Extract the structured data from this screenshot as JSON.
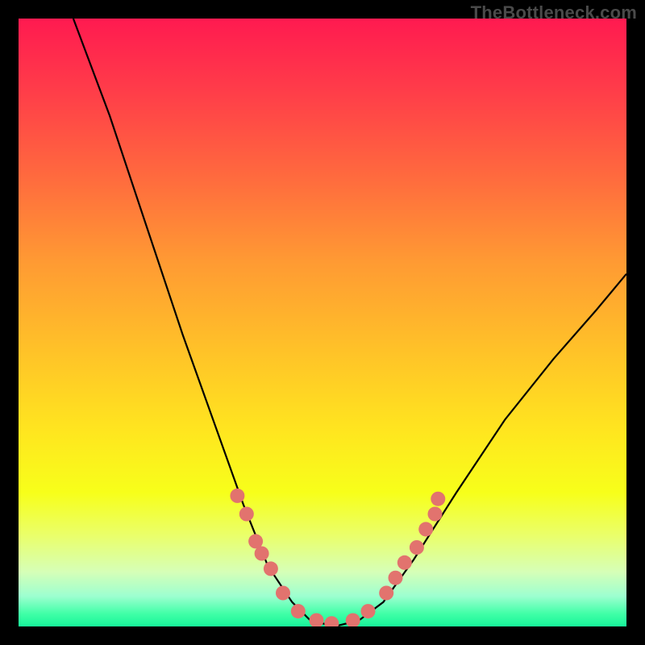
{
  "watermark": "TheBottleneck.com",
  "chart_data": {
    "type": "line",
    "title": "",
    "xlabel": "",
    "ylabel": "",
    "xlim": [
      0,
      100
    ],
    "ylim": [
      0,
      100
    ],
    "grid": false,
    "series": [
      {
        "name": "curve",
        "points": [
          {
            "x": 9,
            "y": 100
          },
          {
            "x": 15,
            "y": 84
          },
          {
            "x": 21,
            "y": 66
          },
          {
            "x": 27,
            "y": 48
          },
          {
            "x": 32,
            "y": 34
          },
          {
            "x": 37,
            "y": 20
          },
          {
            "x": 41,
            "y": 10
          },
          {
            "x": 45,
            "y": 4
          },
          {
            "x": 48,
            "y": 1
          },
          {
            "x": 52,
            "y": 0
          },
          {
            "x": 56,
            "y": 1
          },
          {
            "x": 60,
            "y": 4
          },
          {
            "x": 65,
            "y": 11
          },
          {
            "x": 72,
            "y": 22
          },
          {
            "x": 80,
            "y": 34
          },
          {
            "x": 88,
            "y": 44
          },
          {
            "x": 95,
            "y": 52
          },
          {
            "x": 100,
            "y": 58
          }
        ]
      }
    ],
    "markers": {
      "name": "highlight-dots",
      "color": "#e2736e",
      "left_cluster": [
        {
          "x": 36.0,
          "y": 21.5
        },
        {
          "x": 37.5,
          "y": 18.5
        },
        {
          "x": 39.0,
          "y": 14.0
        },
        {
          "x": 40.0,
          "y": 12.0
        },
        {
          "x": 41.5,
          "y": 9.5
        },
        {
          "x": 43.5,
          "y": 5.5
        }
      ],
      "bottom_cluster": [
        {
          "x": 46.0,
          "y": 2.5
        },
        {
          "x": 49.0,
          "y": 1.0
        },
        {
          "x": 51.5,
          "y": 0.5
        },
        {
          "x": 55.0,
          "y": 1.0
        },
        {
          "x": 57.5,
          "y": 2.5
        }
      ],
      "right_cluster": [
        {
          "x": 60.5,
          "y": 5.5
        },
        {
          "x": 62.0,
          "y": 8.0
        },
        {
          "x": 63.5,
          "y": 10.5
        },
        {
          "x": 65.5,
          "y": 13.0
        },
        {
          "x": 67.0,
          "y": 16.0
        },
        {
          "x": 68.5,
          "y": 18.5
        },
        {
          "x": 69.0,
          "y": 21.0
        }
      ]
    }
  }
}
